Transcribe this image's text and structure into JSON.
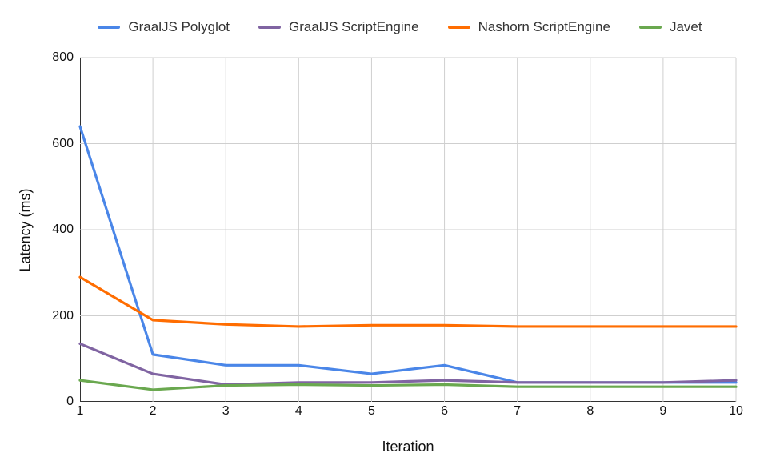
{
  "chart_data": {
    "type": "line",
    "xlabel": "Iteration",
    "ylabel": "Latency (ms)",
    "xlim": [
      1,
      10
    ],
    "ylim": [
      0,
      800
    ],
    "xticks": [
      1,
      2,
      3,
      4,
      5,
      6,
      7,
      8,
      9,
      10
    ],
    "yticks": [
      0,
      200,
      400,
      600,
      800
    ],
    "grid": true,
    "categories": [
      1,
      2,
      3,
      4,
      5,
      6,
      7,
      8,
      9,
      10
    ],
    "series": [
      {
        "name": "GraalJS Polyglot",
        "color": "#4a86e8",
        "values": [
          640,
          110,
          85,
          85,
          65,
          85,
          45,
          45,
          45,
          45
        ]
      },
      {
        "name": "GraalJS ScriptEngine",
        "color": "#8064a2",
        "values": [
          135,
          65,
          40,
          45,
          45,
          50,
          45,
          45,
          45,
          50
        ]
      },
      {
        "name": "Nashorn ScriptEngine",
        "color": "#ff6d01",
        "values": [
          290,
          190,
          180,
          175,
          178,
          178,
          175,
          175,
          175,
          175
        ]
      },
      {
        "name": "Javet",
        "color": "#6aa84f",
        "values": [
          50,
          28,
          38,
          40,
          38,
          40,
          35,
          35,
          35,
          35
        ]
      }
    ]
  }
}
